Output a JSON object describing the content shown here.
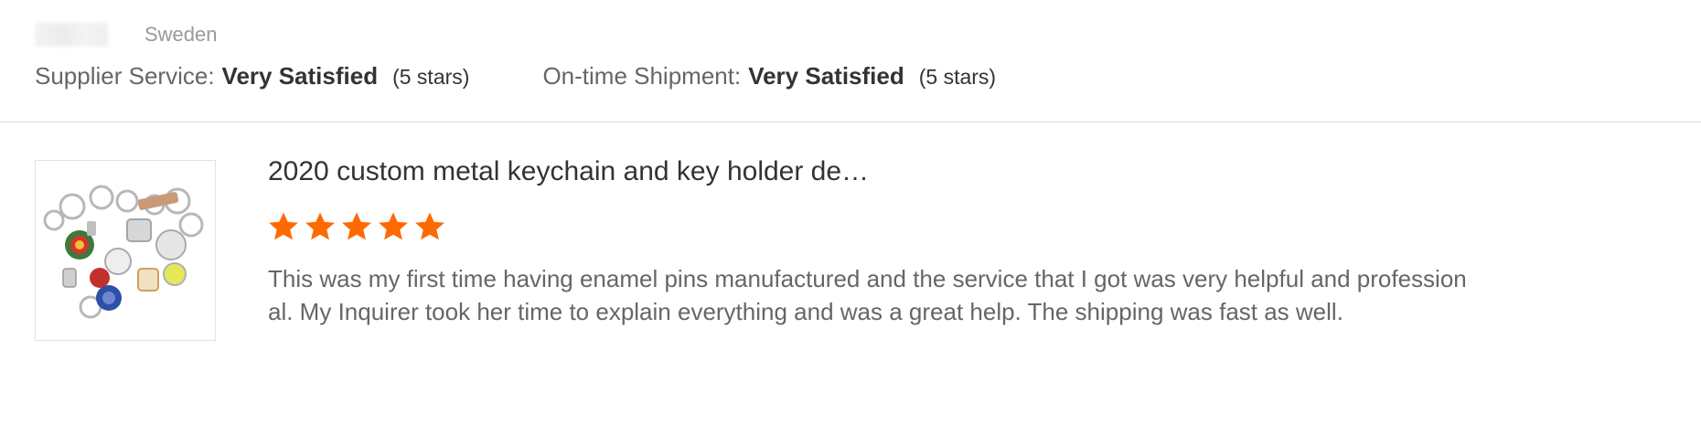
{
  "reviewer": {
    "country": "Sweden"
  },
  "ratings": {
    "supplier_service": {
      "label": "Supplier Service:",
      "value": "Very Satisfied",
      "stars_text": "(5 stars)"
    },
    "on_time_shipment": {
      "label": "On-time Shipment:",
      "value": "Very Satisfied",
      "stars_text": "(5 stars)"
    }
  },
  "product": {
    "title": "2020 custom metal keychain and key holder de…",
    "rating": 5,
    "rating_max": 5,
    "review_text": "This was my first time having enamel pins manufactured and the service that I got was very helpful and professional. My Inquirer took her time to explain everything and was a great help. The shipping was fast as well."
  },
  "colors": {
    "star": "#ff6a00",
    "divider": "#dddddd",
    "text_primary": "#333333",
    "text_secondary": "#666666",
    "text_muted": "#999999"
  },
  "icons": {
    "rating_star": "star-icon",
    "product_image": "keychain-product-image"
  }
}
